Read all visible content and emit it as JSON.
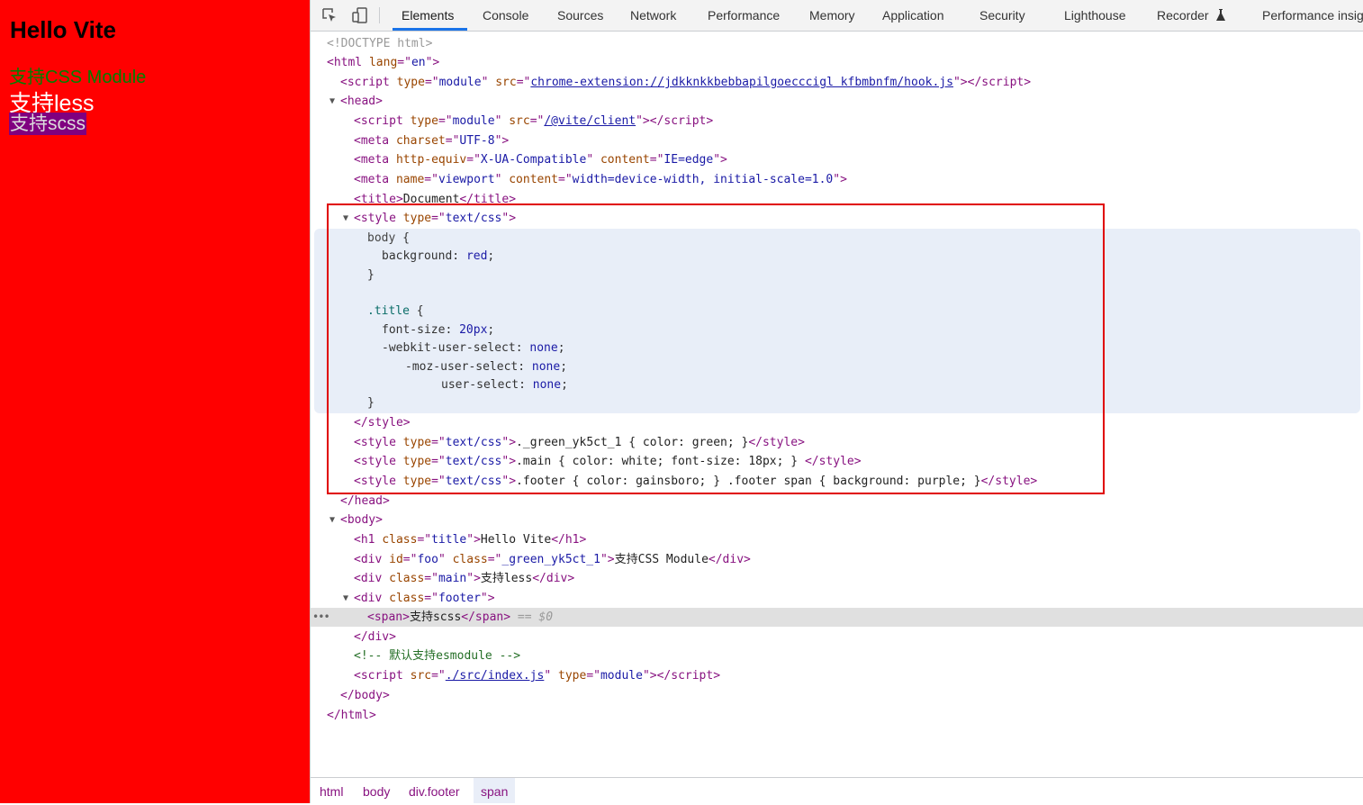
{
  "preview": {
    "title": "Hello Vite",
    "green_text": "支持CSS Module",
    "main_text": "支持less",
    "footer_span": "支持scss",
    "colors": {
      "background": "#ff0000",
      "green": "#008000",
      "main": "#ffffff",
      "footer": "#dcdcdc",
      "footer_span_bg": "#800080"
    }
  },
  "devtools": {
    "tool_icons": [
      "inspect-element-icon",
      "device-toolbar-icon"
    ],
    "tabs": [
      {
        "label": "Elements",
        "active": true
      },
      {
        "label": "Console"
      },
      {
        "label": "Sources"
      },
      {
        "label": "Network"
      },
      {
        "label": "Performance"
      },
      {
        "label": "Memory"
      },
      {
        "label": "Application"
      },
      {
        "label": "Security"
      },
      {
        "label": "Lighthouse"
      },
      {
        "label": "Recorder"
      },
      {
        "label": "Performance insig"
      }
    ],
    "recorder_icon": "flask-icon",
    "tree": {
      "doctype": "<!DOCTYPE html>",
      "html_open_tag": "html",
      "html_lang_attr": "lang",
      "html_lang_val": "en",
      "hook_script_src": "chrome-extension://jdkknkkbebbapilgoecccigl kfbmbnfm/hook.js",
      "vite_client_src": "/@vite/client",
      "charset_val": "UTF-8",
      "http_equiv_val": "X-UA-Compatible",
      "http_equiv_content": "IE=edge",
      "viewport_name": "viewport",
      "viewport_content": "width=device-width, initial-scale=1.0",
      "title_text": "Document",
      "style_type": "text/css",
      "css_body_selector": "body",
      "css_background_prop": "background",
      "css_background_val": "red",
      "css_title_selector": ".title",
      "css_font_size_prop": "font-size",
      "css_font_size_val": "20px",
      "css_webkit_prop": "-webkit-user-select",
      "css_moz_prop": "-moz-user-select",
      "css_user_select_prop": "user-select",
      "css_none_val": "none",
      "style2_text": "._green_yk5ct_1 { color: green; }",
      "style3_text": ".main { color: white; font-size: 18px; }",
      "style4_text": ".footer { color: gainsboro; } .footer span { background: purple; }",
      "h1_class": "title",
      "h1_text": "Hello Vite",
      "foo_id": "foo",
      "foo_class": "_green_yk5ct_1",
      "foo_text": "支持CSS Module",
      "main_class": "main",
      "main_text": "支持less",
      "footer_class": "footer",
      "span_text": "支持scss",
      "selected_marker": "== $0",
      "comment_text": "<!-- 默认支持esmodule -->",
      "index_script_src": "./src/index.js",
      "module_val": "module"
    },
    "breadcrumbs": [
      "html",
      "body",
      "div.footer",
      "span"
    ]
  }
}
